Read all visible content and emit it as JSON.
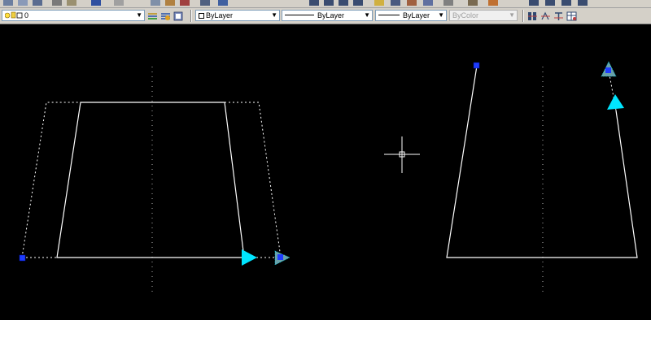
{
  "layer_dropdown": {
    "value": "0"
  },
  "color_dropdown": {
    "value": "ByLayer"
  },
  "linetype_dropdown": {
    "value": "ByLayer"
  },
  "lineweight_dropdown": {
    "value": "ByLayer"
  },
  "plotstyle_dropdown": {
    "value": "ByColor"
  },
  "colors": {
    "canvas": "#000000",
    "geometry": "#ffffff",
    "grip": "#1e3cff",
    "grip_arrow": "#00e5ff",
    "toolbar": "#d4d0c8"
  }
}
